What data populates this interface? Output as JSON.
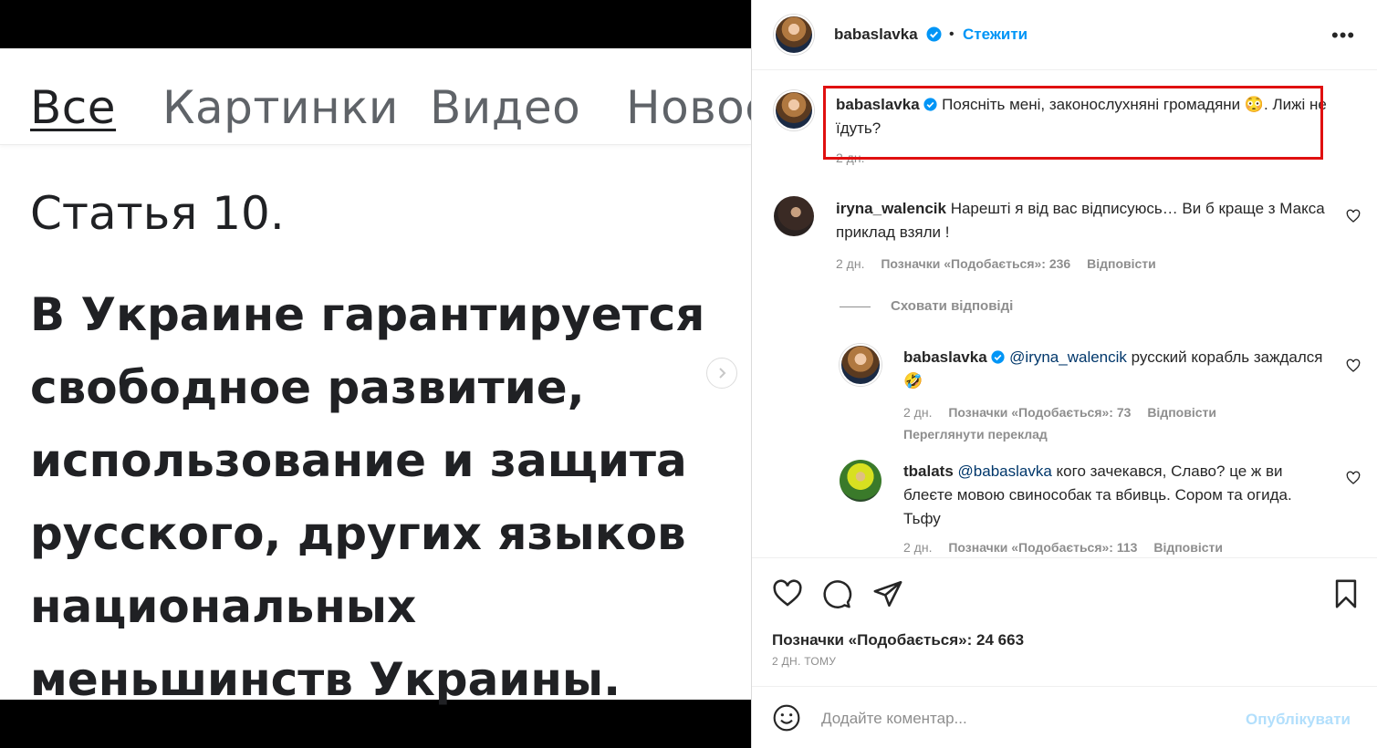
{
  "image": {
    "tabs": [
      "Все",
      "Картинки",
      "Видео",
      "Новос"
    ],
    "heading": "Статья 10.",
    "body_lines": [
      "В Украине гарантируется",
      "свободное развитие,",
      "использование и защита",
      "русского, других языков",
      "национальных",
      "меньшинств Украины."
    ]
  },
  "header": {
    "username": "babaslavka",
    "dot": "•",
    "follow": "Стежити",
    "more": "•••"
  },
  "caption": {
    "username": "babaslavka",
    "text": "Поясніть мені, законослухняні громадяни 😳. Лижі не їдуть?",
    "time": "2 дн."
  },
  "comments": [
    {
      "username": "iryna_walencik",
      "text": "Нарешті я від вас відписуюсь… Ви б краще з Макса приклад взяли !",
      "time": "2 дн.",
      "likes": "Позначки «Подобається»: 236",
      "reply": "Відповісти"
    }
  ],
  "hide_replies": "Сховати відповіді",
  "replies": [
    {
      "username": "babaslavka",
      "mention": "@iryna_walencik",
      "text": "русский корабль заждался 🤣",
      "time": "2 дн.",
      "likes": "Позначки «Подобається»: 73",
      "reply": "Відповісти",
      "translate": "Переглянути переклад"
    },
    {
      "username": "tbalats",
      "mention": "@babaslavka",
      "text": "кого зачекався, Славо? це ж ви блеєте мовою свинособак та вбивць. Сором та огида. Тьфу",
      "time": "2 дн.",
      "likes": "Позначки «Подобається»: 113",
      "reply": "Відповісти"
    }
  ],
  "footer": {
    "likes": "Позначки «Подобається»: 24 663",
    "time_ago": "2 ДН. ТОМУ",
    "comment_placeholder": "Додайте коментар...",
    "publish": "Опублікувати"
  },
  "colors": {
    "accent": "#0095f6",
    "highlight": "#e01010",
    "muted": "#8e8e8e"
  }
}
